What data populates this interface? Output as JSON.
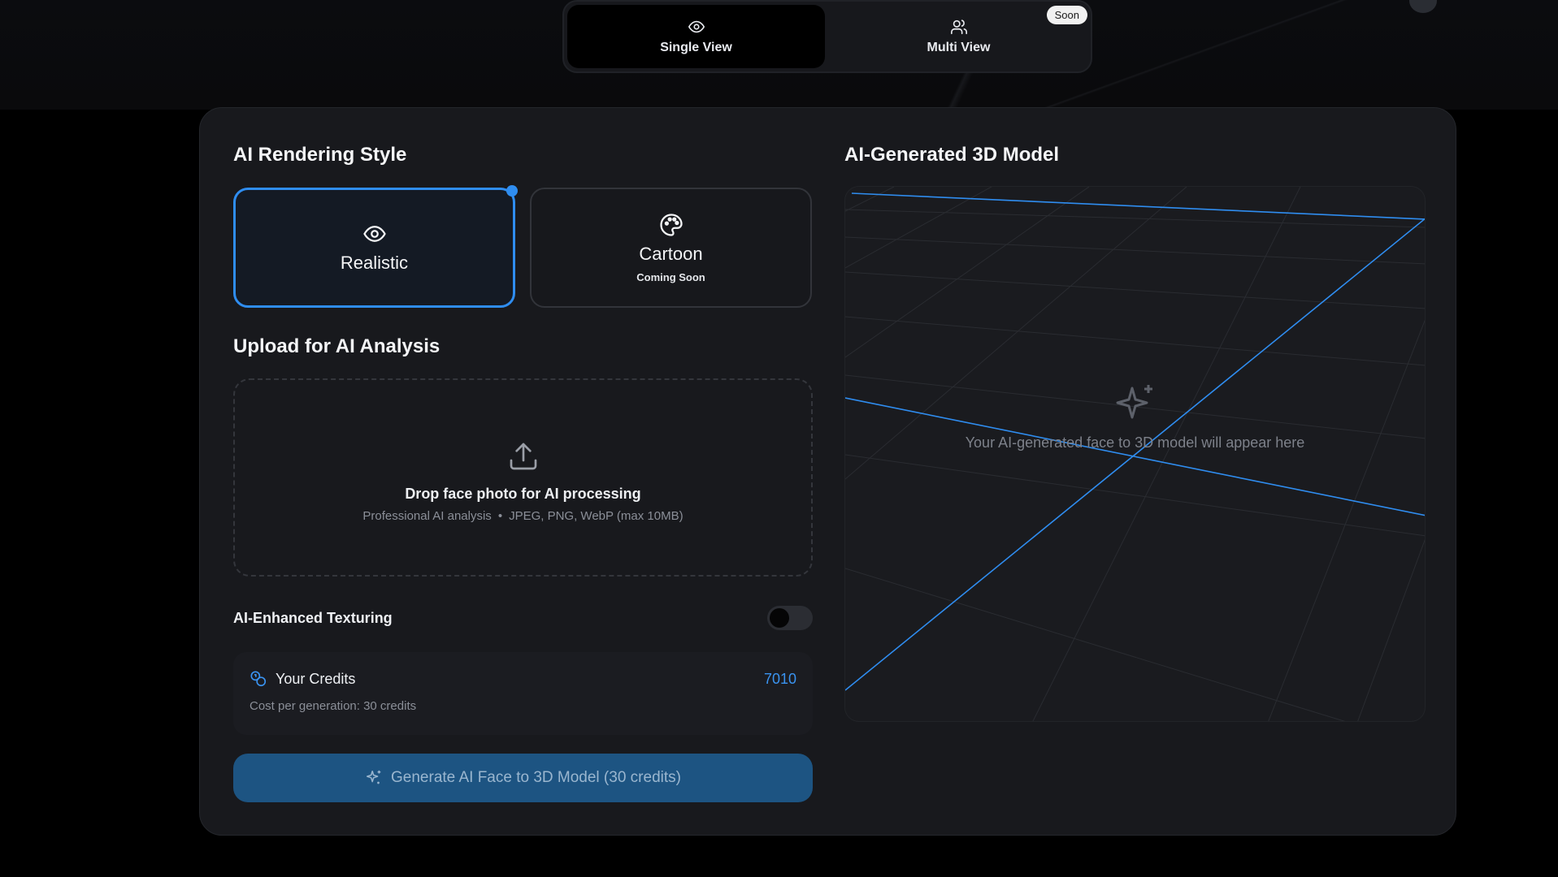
{
  "view_toggle": {
    "single": {
      "label": "Single View",
      "icon": "eye-icon"
    },
    "multi": {
      "label": "Multi View",
      "icon": "users-icon",
      "badge": "Soon"
    }
  },
  "rendering": {
    "title": "AI Rendering Style",
    "options": [
      {
        "name": "Realistic",
        "icon": "eye-icon",
        "selected": true
      },
      {
        "name": "Cartoon",
        "icon": "palette-icon",
        "sub": "Coming Soon"
      }
    ]
  },
  "upload": {
    "title": "Upload for AI Analysis",
    "drop_title": "Drop face photo for AI processing",
    "drop_sub_1": "Professional AI analysis",
    "drop_sep": "•",
    "drop_sub_2": "JPEG, PNG, WebP (max 10MB)",
    "icon": "upload-icon"
  },
  "texturing": {
    "label": "AI-Enhanced Texturing",
    "enabled": false
  },
  "credits": {
    "label": "Your Credits",
    "value": "7010",
    "cost": "Cost per generation: 30 credits",
    "icon": "coins-icon"
  },
  "generate_button": {
    "label": "Generate AI Face to 3D Model (30 credits)",
    "icon": "sparkles-icon"
  },
  "model_panel": {
    "title": "AI-Generated 3D Model",
    "placeholder": "Your AI-generated face to 3D model will appear here",
    "icon": "sparkles-icon"
  },
  "colors": {
    "accent": "#2f8df0",
    "button": "#1d5482",
    "card": "#18191d"
  }
}
